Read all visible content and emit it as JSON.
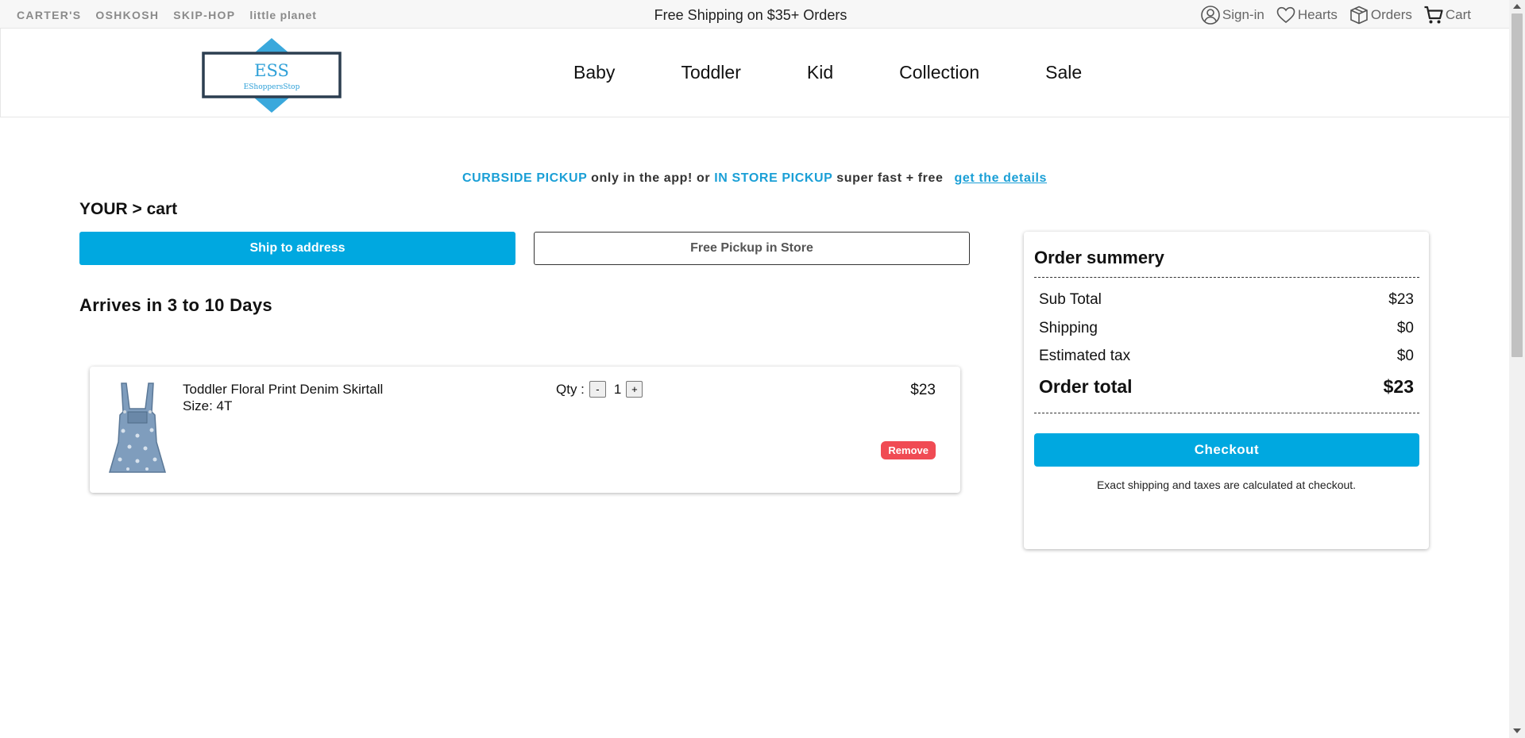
{
  "topbar": {
    "brands": [
      "CARTER'S",
      "OSHKOSH",
      "SKIP-HOP",
      "little planet"
    ],
    "promo": "Free Shipping on $35+ Orders",
    "utilities": [
      {
        "label": "Sign-in",
        "icon": "user-circle-icon"
      },
      {
        "label": "Hearts",
        "icon": "heart-icon"
      },
      {
        "label": "Orders",
        "icon": "box-icon"
      },
      {
        "label": "Cart",
        "icon": "cart-icon"
      }
    ]
  },
  "logo": {
    "title": "ESS",
    "subtitle": "EShoppersStop"
  },
  "nav": [
    "Baby",
    "Toddler",
    "Kid",
    "Collection",
    "Sale"
  ],
  "pickup_banner": {
    "curbside": "CURBSIDE PICKUP",
    "text1": " only in the app! or ",
    "instore": "IN STORE PICKUP",
    "text2": " super fast + free",
    "link": "get the details"
  },
  "cart_title": "YOUR > cart",
  "delivery_options": {
    "ship": "Ship to address",
    "pickup": "Free Pickup in Store"
  },
  "arrives": "Arrives in 3 to 10 Days",
  "item": {
    "name": "Toddler Floral Print Denim Skirtall",
    "size": "Size: 4T",
    "qty_label": "Qty :",
    "qty": "1",
    "minus": "-",
    "plus": "+",
    "price": "$23",
    "remove": "Remove"
  },
  "summary": {
    "title": "Order summery",
    "rows": [
      {
        "label": "Sub Total",
        "value": "$23"
      },
      {
        "label": "Shipping",
        "value": "$0"
      },
      {
        "label": "Estimated tax",
        "value": "$0"
      }
    ],
    "total": {
      "label": "Order total",
      "value": "$23"
    },
    "checkout": "Checkout",
    "note": "Exact shipping and taxes are calculated at checkout."
  },
  "colors": {
    "accent": "#00a8e0",
    "highlight": "#1a9fd6",
    "remove": "#f04b54",
    "logo_diamond": "#3aa8dc",
    "logo_frame": "#2c3e50"
  }
}
